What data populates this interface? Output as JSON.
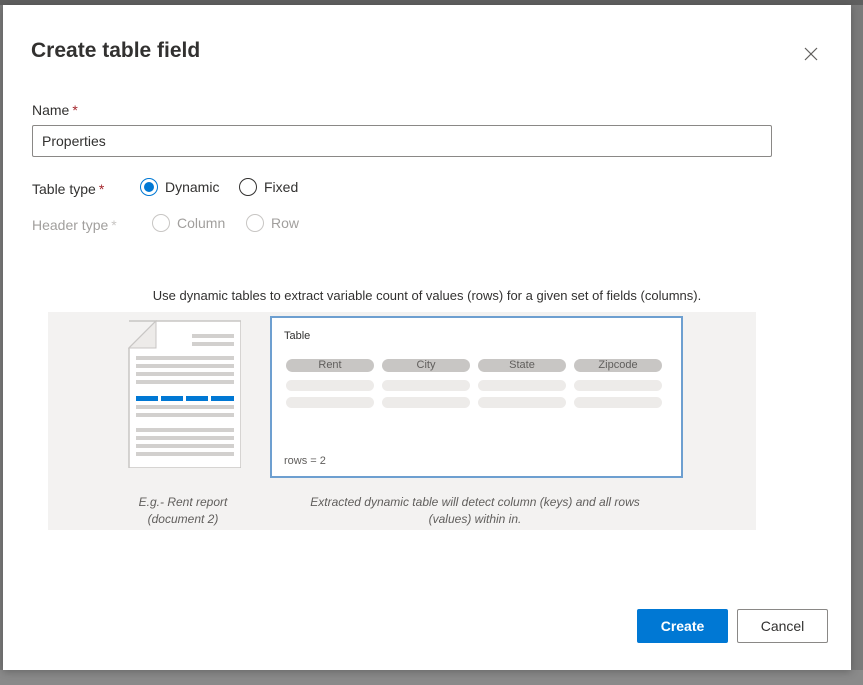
{
  "dialog": {
    "title": "Create table field",
    "close_icon": "close-icon"
  },
  "name_field": {
    "label": "Name",
    "required_mark": "*",
    "value": "Properties"
  },
  "table_type": {
    "label": "Table type",
    "required_mark": "*",
    "options": [
      "Dynamic",
      "Fixed"
    ],
    "selected": "Dynamic"
  },
  "header_type": {
    "label": "Header type",
    "required_mark": "*",
    "options": [
      "Column",
      "Row"
    ],
    "disabled": true
  },
  "description": "Use dynamic tables to extract variable count of values (rows) for a given set of fields (columns).",
  "illustration": {
    "table_title": "Table",
    "columns": [
      "Rent",
      "City",
      "State",
      "Zipcode"
    ],
    "rows_text": "rows = 2",
    "doc_caption_line1": "E.g.- Rent report",
    "doc_caption_line2": "(document 2)",
    "table_caption_line1": "Extracted dynamic table will detect column (keys) and all rows",
    "table_caption_line2": "(values) within in.",
    "highlight_color": "#0078d4"
  },
  "buttons": {
    "create": "Create",
    "cancel": "Cancel"
  },
  "colors": {
    "accent": "#0078d4",
    "required": "#a4262c"
  }
}
